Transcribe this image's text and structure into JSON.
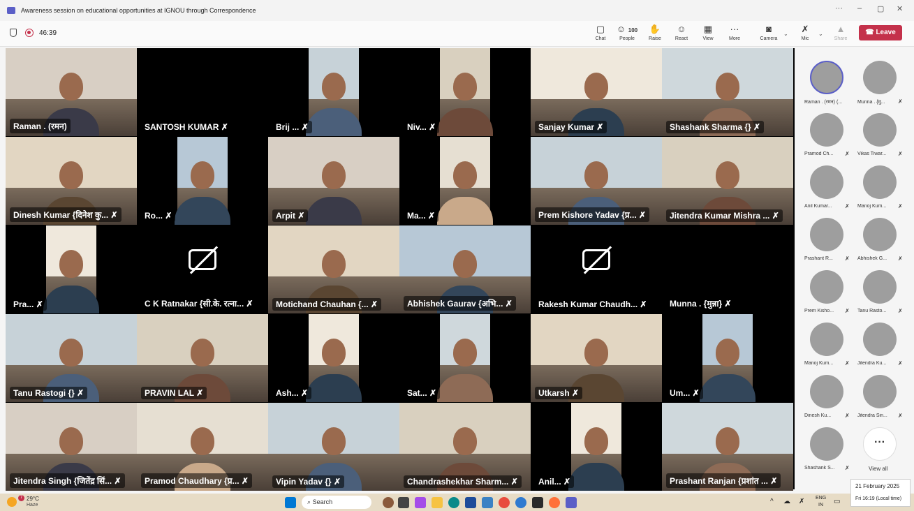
{
  "window": {
    "title": "Awareness session on educational opportunities at IGNOU through Correspondence",
    "controls": [
      "···",
      "–",
      "▢",
      "✕"
    ]
  },
  "toolbar": {
    "timer": "46:39",
    "chat": "Chat",
    "people": "People",
    "people_count": "100",
    "raise": "Raise",
    "react": "React",
    "view": "View",
    "more": "More",
    "camera": "Camera",
    "mic": "Mic",
    "share": "Share",
    "leave": "Leave"
  },
  "tiles": [
    {
      "name": "Raman . (रमन)",
      "muted": false,
      "cam": "on"
    },
    {
      "name": "SANTOSH KUMAR",
      "muted": true,
      "cam": "black"
    },
    {
      "name": "Brij ...",
      "muted": true,
      "cam": "on"
    },
    {
      "name": "Niv...",
      "muted": true,
      "cam": "on"
    },
    {
      "name": "Sanjay Kumar",
      "muted": true,
      "cam": "on"
    },
    {
      "name": "Shashank Sharma {}",
      "muted": true,
      "cam": "on"
    },
    {
      "name": "Dinesh Kumar {दिनेश कु...",
      "muted": true,
      "cam": "on"
    },
    {
      "name": "Ro...",
      "muted": true,
      "cam": "on"
    },
    {
      "name": "Arpit",
      "muted": true,
      "cam": "on"
    },
    {
      "name": "Ma...",
      "muted": true,
      "cam": "on"
    },
    {
      "name": "Prem Kishore Yadav {प्र...",
      "muted": true,
      "cam": "on"
    },
    {
      "name": "Jitendra Kumar Mishra ...",
      "muted": true,
      "cam": "on"
    },
    {
      "name": "Pra...",
      "muted": true,
      "cam": "on"
    },
    {
      "name": "C K Ratnakar {सी.के. रत्ना...",
      "muted": true,
      "cam": "off"
    },
    {
      "name": "Motichand Chauhan {...",
      "muted": true,
      "cam": "on"
    },
    {
      "name": "Abhishek Gaurav {अभि...",
      "muted": true,
      "cam": "on"
    },
    {
      "name": "Rakesh Kumar Chaudh...",
      "muted": true,
      "cam": "off"
    },
    {
      "name": "Munna . {मुन्ना}",
      "muted": true,
      "cam": "black"
    },
    {
      "name": "Tanu Rastogi {}",
      "muted": true,
      "cam": "on"
    },
    {
      "name": "PRAVIN LAL",
      "muted": true,
      "cam": "on"
    },
    {
      "name": "Ash...",
      "muted": true,
      "cam": "on"
    },
    {
      "name": "Sat...",
      "muted": true,
      "cam": "on"
    },
    {
      "name": "Utkarsh",
      "muted": true,
      "cam": "on"
    },
    {
      "name": "Um...",
      "muted": true,
      "cam": "on"
    },
    {
      "name": "Jitendra Singh {जितेंद्र सिं...",
      "muted": true,
      "cam": "on"
    },
    {
      "name": "Pramod Chaudhary {प्र...",
      "muted": true,
      "cam": "on"
    },
    {
      "name": "Vipin Yadav {}",
      "muted": true,
      "cam": "on"
    },
    {
      "name": "Chandrashekhar Sharm...",
      "muted": true,
      "cam": "on"
    },
    {
      "name": "Anil...",
      "muted": true,
      "cam": "on"
    },
    {
      "name": "Prashant Ranjan {प्रशांत ...",
      "muted": true,
      "cam": "on"
    }
  ],
  "sidebar": {
    "participants": [
      "Raman . (रमन) (...",
      "Munna . {मु...",
      "Pramod Ch...",
      "Vikas Tiwar...",
      "Anil Kumar...",
      "Manoj Kum...",
      "Prashant R...",
      "Abhishek G...",
      "Prem Kisho...",
      "Tanu Rasto...",
      "Manoj Kum...",
      "Jitendra Ku...",
      "Dinesh Ku...",
      "Jitendra Sin...",
      "Shashank S..."
    ],
    "view_all": "View all",
    "more_glyph": "···"
  },
  "taskbar": {
    "weather_temp": "29°C",
    "weather_desc": "Haze",
    "weather_badge": "7",
    "search_placeholder": "Search",
    "lang": "ENG",
    "lang_region": "IN",
    "tooltip_date": "21 February 2025",
    "tooltip_time": "Fri 16:19 (Local time)"
  }
}
